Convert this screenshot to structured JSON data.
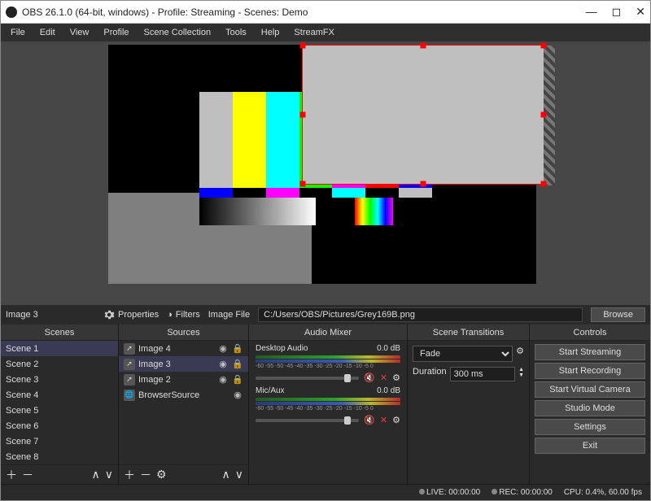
{
  "window": {
    "title": "OBS 26.1.0 (64-bit, windows) - Profile: Streaming - Scenes: Demo"
  },
  "menu": [
    "File",
    "Edit",
    "View",
    "Profile",
    "Scene Collection",
    "Tools",
    "Help",
    "StreamFX"
  ],
  "propsbar": {
    "selected_source": "Image 3",
    "properties_label": "Properties",
    "filters_label": "Filters",
    "field_label": "Image File",
    "path": "C:/Users/OBS/Pictures/Grey169B.png",
    "browse_label": "Browse"
  },
  "panels": {
    "scenes_header": "Scenes",
    "sources_header": "Sources",
    "mixer_header": "Audio Mixer",
    "transitions_header": "Scene Transitions",
    "controls_header": "Controls"
  },
  "scenes": [
    "Scene 1",
    "Scene 2",
    "Scene 3",
    "Scene 4",
    "Scene 5",
    "Scene 6",
    "Scene 7",
    "Scene 8"
  ],
  "scenes_selected": "Scene 1",
  "sources": [
    {
      "name": "Image 4",
      "icon": "image",
      "visible": true,
      "locked": true
    },
    {
      "name": "Image 3",
      "icon": "image",
      "visible": true,
      "locked": true,
      "selected": true
    },
    {
      "name": "Image 2",
      "icon": "image",
      "visible": true,
      "locked": true
    },
    {
      "name": "BrowserSource",
      "icon": "globe",
      "visible": true,
      "locked": false
    }
  ],
  "mixer": {
    "channels": [
      {
        "name": "Desktop Audio",
        "level": "0.0 dB"
      },
      {
        "name": "Mic/Aux",
        "level": "0.0 dB"
      }
    ],
    "ticks": "-60  -55  -50  -45  -40  -35  -30  -25  -20  -15  -10  -5   0"
  },
  "transitions": {
    "current": "Fade",
    "duration_label": "Duration",
    "duration_value": "300 ms"
  },
  "controls": {
    "start_streaming": "Start Streaming",
    "start_recording": "Start Recording",
    "start_virtual_camera": "Start Virtual Camera",
    "studio_mode": "Studio Mode",
    "settings": "Settings",
    "exit": "Exit"
  },
  "status": {
    "live": "LIVE: 00:00:00",
    "rec": "REC: 00:00:00",
    "cpu": "CPU: 0.4%, 60.00 fps"
  },
  "colors": {
    "accent_select": "#f00"
  }
}
